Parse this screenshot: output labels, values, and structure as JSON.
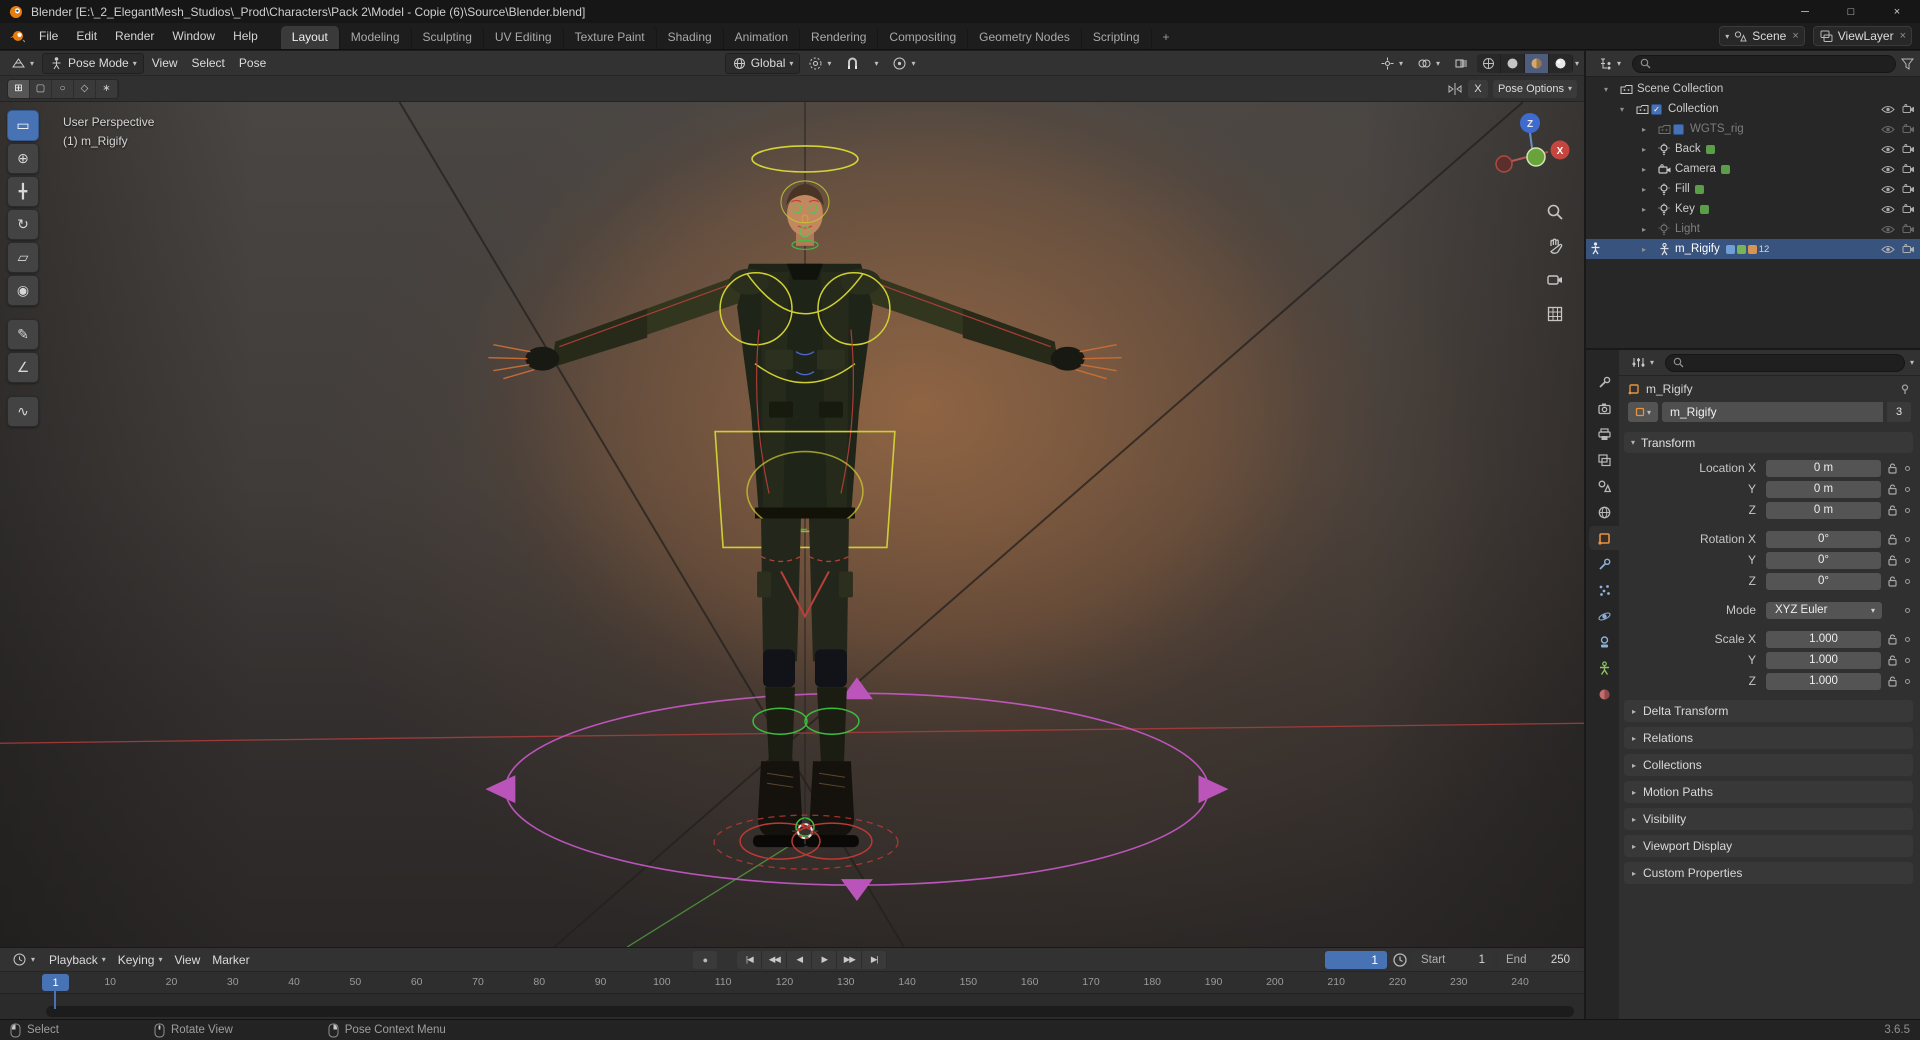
{
  "titlebar": {
    "title": "Blender [E:\\_2_ElegantMesh_Studios\\_Prod\\Characters\\Pack 2\\Model - Copie (6)\\Source\\Blender.blend]",
    "minimize": "─",
    "maximize": "□",
    "close": "×"
  },
  "topbar": {
    "menus": [
      {
        "label": "File"
      },
      {
        "label": "Edit"
      },
      {
        "label": "Render"
      },
      {
        "label": "Window"
      },
      {
        "label": "Help"
      }
    ],
    "workspaces": [
      {
        "label": "Layout",
        "cls": "active"
      },
      {
        "label": "Modeling"
      },
      {
        "label": "Sculpting"
      },
      {
        "label": "UV Editing"
      },
      {
        "label": "Texture Paint"
      },
      {
        "label": "Shading"
      },
      {
        "label": "Animation"
      },
      {
        "label": "Rendering"
      },
      {
        "label": "Compositing"
      },
      {
        "label": "Geometry Nodes"
      },
      {
        "label": "Scripting"
      },
      {
        "label": "+",
        "cls": "add"
      }
    ],
    "scene": {
      "label": "Scene",
      "close": "×"
    },
    "viewlayer": {
      "label": "ViewLayer",
      "close": "×"
    }
  },
  "viewport": {
    "header": {
      "mode": "Pose Mode",
      "menus": [
        {
          "label": "View"
        },
        {
          "label": "Select"
        },
        {
          "label": "Pose"
        }
      ],
      "orientation": "Global"
    },
    "select_modes": [
      {
        "g": "⊞",
        "cls": "on",
        "name": "select-mode-tweak"
      },
      {
        "g": "▢",
        "name": "select-mode-box"
      },
      {
        "g": "○",
        "name": "select-mode-circle"
      },
      {
        "g": "◇",
        "name": "select-mode-lasso"
      },
      {
        "g": "∗",
        "name": "select-mode-paint"
      }
    ],
    "tool_settings": {
      "mirror_x": "X",
      "options": "Pose Options"
    },
    "overlay": {
      "line1": "User Perspective",
      "line2": "(1) m_Rigify"
    },
    "gizmo": {
      "z": "Z",
      "x": "X"
    },
    "tools": [
      {
        "g": "▭",
        "name": "select-box-tool",
        "cls": "active"
      },
      {
        "g": "⊕",
        "name": "cursor-tool"
      },
      {
        "g": "╋",
        "name": "move-tool"
      },
      {
        "g": "↻",
        "name": "rotate-tool"
      },
      {
        "g": "▱",
        "name": "scale-tool"
      },
      {
        "g": "◉",
        "name": "transform-tool"
      },
      {
        "g": "✎",
        "name": "annotate-tool",
        "cls": "gap"
      },
      {
        "g": "∠",
        "name": "measure-tool"
      },
      {
        "g": "∿",
        "name": "pose-breakdowner-tool",
        "cls": "gap"
      }
    ]
  },
  "outliner": {
    "rows": [
      {
        "label": "Scene Collection",
        "cls": "d0",
        "arrow": "▾",
        "ic_col": true
      },
      {
        "label": "Collection",
        "cls": "d1",
        "arrow": "▾",
        "ic_col": true,
        "chk": "✓",
        "eye": true,
        "cam": true
      },
      {
        "label": "WGTS_rig",
        "cls": "d2 dim",
        "arrow": "▸",
        "ic_col": true,
        "chk": true,
        "eye": true,
        "cam": true
      },
      {
        "label": "Back",
        "cls": "d2",
        "arrow": "▸",
        "ic_light": true,
        "dat": true,
        "eye": true,
        "cam": true
      },
      {
        "label": "Camera",
        "cls": "d2",
        "arrow": "▸",
        "ic_camobj": true,
        "dat": true,
        "eye": true,
        "cam": true
      },
      {
        "label": "Fill",
        "cls": "d2",
        "arrow": "▸",
        "ic_light": true,
        "dat": true,
        "eye": true,
        "cam": true
      },
      {
        "label": "Key",
        "cls": "d2",
        "arrow": "▸",
        "ic_light": true,
        "dat": true,
        "eye": true,
        "cam": true
      },
      {
        "label": "Light",
        "cls": "d2 dim",
        "arrow": "▸",
        "ic_light": true,
        "eye": true,
        "cam": true
      },
      {
        "label": "m_Rigify",
        "cls": "d2 selected",
        "arrow": "▸",
        "ic_arm": true,
        "pose": true,
        "datas": true,
        "badge": "12",
        "eye": true,
        "cam": true
      }
    ]
  },
  "properties": {
    "breadcrumb": "m_Rigify",
    "name_value": "m_Rigify",
    "users": "3",
    "transform_title": "Transform",
    "rows": [
      {
        "label": "Location X",
        "value": "0 m"
      },
      {
        "label": "Y",
        "value": "0 m"
      },
      {
        "label": "Z",
        "value": "0 m"
      },
      {
        "label": "Rotation X",
        "value": "0°",
        "cls": "gap"
      },
      {
        "label": "Y",
        "value": "0°"
      },
      {
        "label": "Z",
        "value": "0°"
      },
      {
        "label": "Mode",
        "value": "XYZ Euler",
        "cls": "gap nolock hascaret",
        "caret": "▾"
      },
      {
        "label": "Scale X",
        "value": "1.000",
        "cls": "gap"
      },
      {
        "label": "Y",
        "value": "1.000"
      },
      {
        "label": "Z",
        "value": "1.000"
      }
    ],
    "sections": [
      {
        "label": "Delta Transform"
      },
      {
        "label": "Relations"
      },
      {
        "label": "Collections"
      },
      {
        "label": "Motion Paths"
      },
      {
        "label": "Visibility"
      },
      {
        "label": "Viewport Display"
      },
      {
        "label": "Custom Properties"
      }
    ],
    "tabs": [
      {
        "ic_tool": true,
        "name": "tool-tab"
      },
      {
        "ic_render": true,
        "name": "render-tab"
      },
      {
        "ic_output": true,
        "name": "output-tab"
      },
      {
        "ic_vlayer": true,
        "name": "view-layer-tab"
      },
      {
        "ic_scene": true,
        "name": "scene-tab"
      },
      {
        "ic_world": true,
        "name": "world-tab"
      },
      {
        "ic_object": true,
        "name": "object-tab",
        "cls": "active"
      },
      {
        "ic_mod": true,
        "name": "modifiers-tab"
      },
      {
        "ic_part": true,
        "name": "particles-tab"
      },
      {
        "ic_phys": true,
        "name": "physics-tab"
      },
      {
        "ic_const": true,
        "name": "constraints-tab"
      },
      {
        "ic_data": true,
        "name": "object-data-tab"
      },
      {
        "ic_mat": true,
        "name": "material-tab"
      }
    ]
  },
  "timeline": {
    "menus": [
      {
        "label": "Playback",
        "caret": "▾"
      },
      {
        "label": "Keying",
        "caret": "▾"
      },
      {
        "label": "View"
      },
      {
        "label": "Marker"
      }
    ],
    "record": "●",
    "buttons": [
      {
        "g": "|◀",
        "name": "jump-to-start-button"
      },
      {
        "g": "◀◀",
        "name": "prev-keyframe-button"
      },
      {
        "g": "◀",
        "name": "play-reverse-button"
      },
      {
        "g": "▶",
        "name": "play-button"
      },
      {
        "g": "▶▶",
        "name": "next-keyframe-button"
      },
      {
        "g": "▶|",
        "name": "jump-to-end-button"
      }
    ],
    "frame": "1",
    "playhead": "1",
    "start_label": "Start",
    "start_value": "1",
    "end_label": "End",
    "end_value": "250",
    "ticks": [
      1,
      10,
      20,
      30,
      40,
      50,
      60,
      70,
      80,
      90,
      100,
      110,
      120,
      130,
      140,
      150,
      160,
      170,
      180,
      190,
      200,
      210,
      220,
      230,
      240
    ]
  },
  "statusbar": {
    "items": [
      {
        "label": "Select",
        "ic_l": true
      },
      {
        "label": "Rotate View",
        "ic_m": true
      },
      {
        "label": "Pose Context Menu",
        "ic_r": true
      }
    ],
    "version": "3.6.5"
  }
}
